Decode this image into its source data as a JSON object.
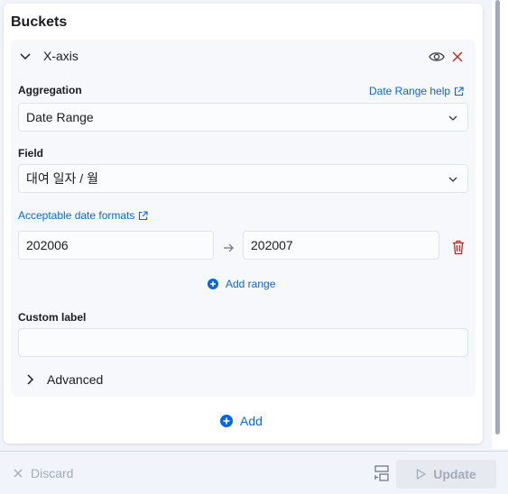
{
  "panel": {
    "title": "Buckets"
  },
  "bucket": {
    "title": "X-axis",
    "aggregation": {
      "label": "Aggregation",
      "help_link": "Date Range help",
      "value": "Date Range"
    },
    "field": {
      "label": "Field",
      "value": "대여 일자 / 월"
    },
    "date_formats_link": "Acceptable date formats",
    "range": {
      "from": "202006",
      "to": "202007"
    },
    "add_range_label": "Add range",
    "custom_label": {
      "label": "Custom label",
      "value": ""
    },
    "advanced_label": "Advanced"
  },
  "add_label": "Add",
  "footer": {
    "discard_label": "Discard",
    "update_label": "Update"
  },
  "colors": {
    "accent": "#0b64dd",
    "danger": "#bd271e",
    "disabled": "#a2abba"
  }
}
